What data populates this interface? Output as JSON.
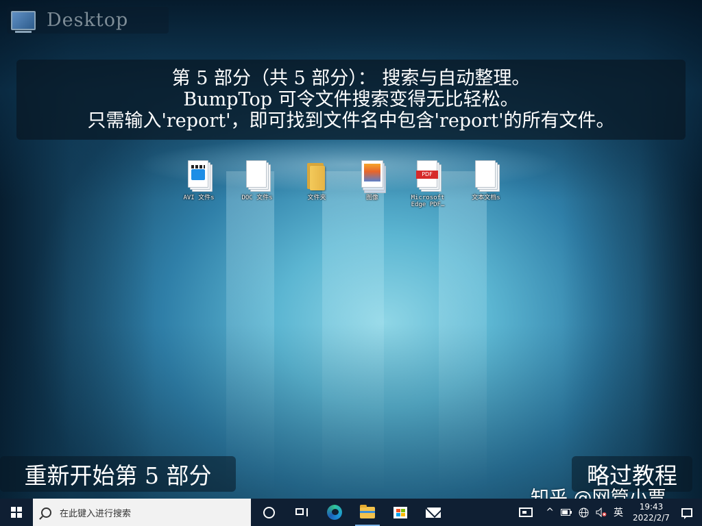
{
  "desktop": {
    "title": "Desktop"
  },
  "tutorial": {
    "line1": "第 5 部分（共 5 部分）： 搜索与自动整理。",
    "line2": "BumpTop 可令文件搜索变得无比轻松。",
    "line3": "只需输入'report'，即可找到文件名中包含'report'的所有文件。"
  },
  "icons": [
    {
      "label": "AVI 文件s",
      "icon": "video-file-icon"
    },
    {
      "label": "DOC 文件s",
      "icon": "document-file-icon"
    },
    {
      "label": "文件夹",
      "icon": "folder-icon"
    },
    {
      "label": "图像",
      "icon": "image-file-icon"
    },
    {
      "label1": "Microsoft",
      "label2": "Edge PDF…",
      "icon": "pdf-file-icon"
    },
    {
      "label": "文本文档s",
      "icon": "text-file-icon"
    }
  ],
  "buttons": {
    "restart": "重新开始第 5 部分",
    "skip": "略过教程"
  },
  "watermark": "知乎 @网管小贾",
  "taskbar": {
    "search_placeholder": "在此键入进行搜索",
    "ime": "英",
    "time": "19:43",
    "date": "2022/2/7",
    "tray_chevron": "^"
  },
  "colors": {
    "taskbar_bg": "#0f1f33",
    "panel_bg": "rgba(8,24,36,0.72)",
    "accent": "#7fb7ea"
  }
}
